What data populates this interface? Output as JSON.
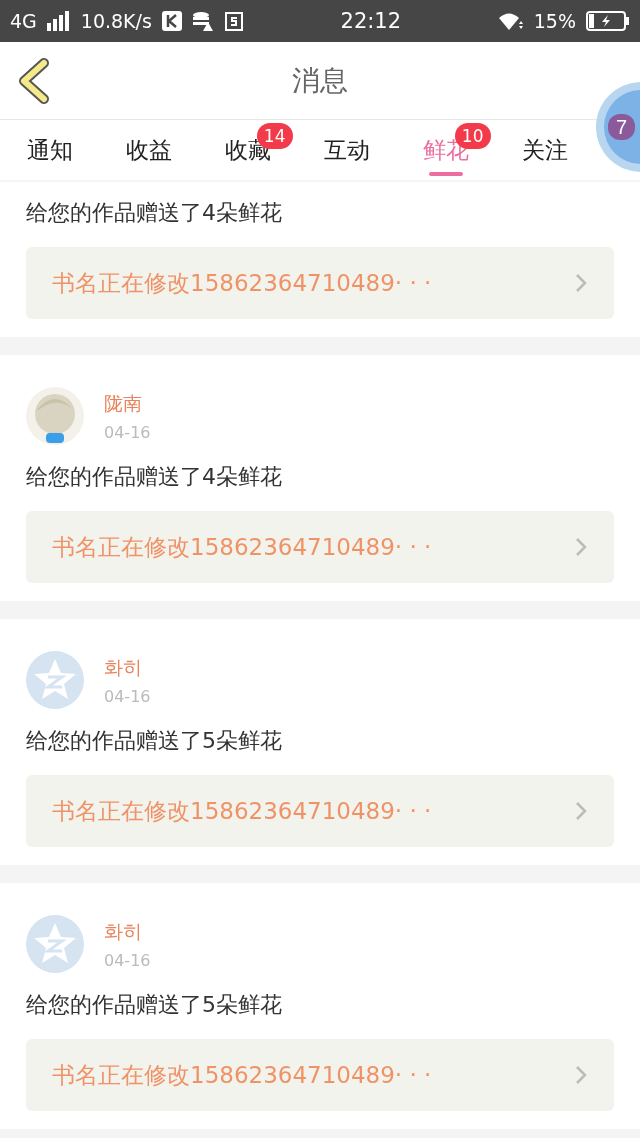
{
  "status_bar": {
    "network": "4G",
    "speed": "10.8K/s",
    "time": "22:12",
    "battery": "15%"
  },
  "header": {
    "title": "消息"
  },
  "tabs": [
    {
      "label": "通知",
      "selected": false
    },
    {
      "label": "收益",
      "selected": false
    },
    {
      "label": "收藏",
      "selected": false,
      "badge": "14"
    },
    {
      "label": "互动",
      "selected": false
    },
    {
      "label": "鲜花",
      "selected": true,
      "badge": "10"
    },
    {
      "label": "关注",
      "selected": false
    }
  ],
  "floating_button": {
    "text": "7"
  },
  "feed": [
    {
      "message": "给您的作品赠送了4朵鲜花",
      "book": "书名正在修改15862364710489· · ·"
    },
    {
      "user": "陇南",
      "date": "04-16",
      "message": "给您的作品赠送了4朵鲜花",
      "book": "书名正在修改15862364710489· · ·"
    },
    {
      "user": "화히",
      "date": "04-16",
      "avatar": {
        "kind": "default"
      },
      "message": "给您的作品赠送了5朵鲜花",
      "book": "书名正在修改15862364710489· · ·"
    },
    {
      "user": "화히",
      "date": "04-16",
      "avatar": {
        "kind": "default"
      },
      "message": "给您的作品赠送了5朵鲜花",
      "book": "书名正在修改15862364710489· · ·"
    }
  ]
}
